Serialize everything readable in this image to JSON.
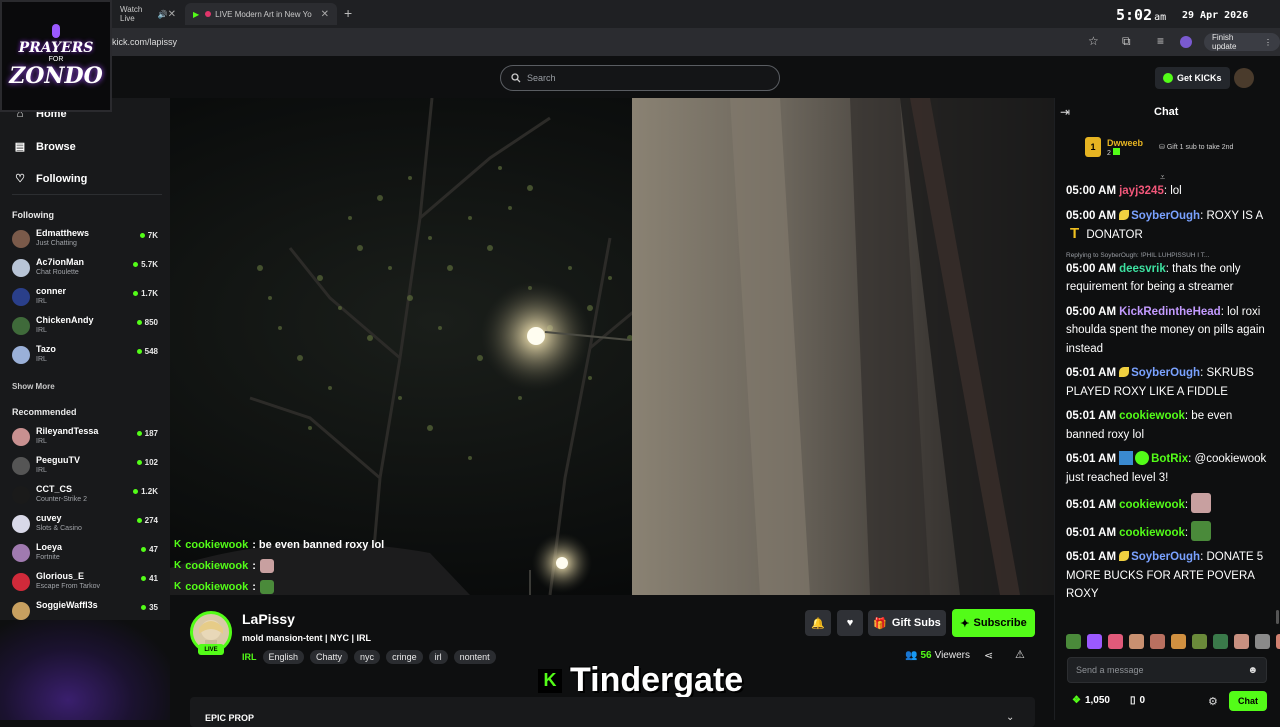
{
  "browser": {
    "tabs": [
      {
        "label": "Watch Live",
        "audio_icon": "speaker-icon"
      },
      {
        "label": "LIVE Modern Art in New Yo"
      }
    ],
    "clock_time": "5:02",
    "clock_ampm": "am",
    "clock_date": "29 Apr 2026",
    "url": "kick.com/lapissy",
    "update_label": "Finish update"
  },
  "overlay_logo": {
    "line1": "PRAYERS",
    "line2": "FOR",
    "line3": "ZONDO"
  },
  "header": {
    "search_placeholder": "Search",
    "get_kicks_label": "Get KICKs"
  },
  "sidebar": {
    "nav": [
      {
        "label": "Home",
        "icon": "home-icon"
      },
      {
        "label": "Browse",
        "icon": "browse-icon"
      },
      {
        "label": "Following",
        "icon": "heart-icon"
      }
    ],
    "following_label": "Following",
    "following": [
      {
        "name": "Edmatthews",
        "category": "Just Chatting",
        "viewers": "7K",
        "color": "#7a5a4a"
      },
      {
        "name": "Ac7ionMan",
        "category": "Chat Roulette",
        "viewers": "5.7K",
        "color": "#b8c4d6"
      },
      {
        "name": "conner",
        "category": "IRL",
        "viewers": "1.7K",
        "color": "#2a3f8a"
      },
      {
        "name": "ChickenAndy",
        "category": "IRL",
        "viewers": "850",
        "color": "#3f6a3a"
      },
      {
        "name": "Tazo",
        "category": "IRL",
        "viewers": "548",
        "color": "#9ab0d8"
      }
    ],
    "show_more_label": "Show More",
    "recommended_label": "Recommended",
    "recommended": [
      {
        "name": "RileyandTessa",
        "category": "IRL",
        "viewers": "187",
        "color": "#c89090"
      },
      {
        "name": "PeeguuTV",
        "category": "IRL",
        "viewers": "102",
        "color": "#555555"
      },
      {
        "name": "CCT_CS",
        "category": "Counter-Strike 2",
        "viewers": "1.2K",
        "color": "#1a1a1a"
      },
      {
        "name": "cuvey",
        "category": "Slots & Casino",
        "viewers": "274",
        "color": "#d8d8e8"
      },
      {
        "name": "Loeya",
        "category": "Fortnite",
        "viewers": "47",
        "color": "#a07ab0"
      },
      {
        "name": "Glorious_E",
        "category": "Escape From Tarkov",
        "viewers": "41",
        "color": "#d02a3a"
      },
      {
        "name": "SoggieWaffl3s",
        "category": "",
        "viewers": "35",
        "color": "#c8a060"
      }
    ]
  },
  "video_overlay_chat": [
    {
      "user": "cookiewook",
      "text": ": be even banned roxy lol",
      "emote_color": ""
    },
    {
      "user": "cookiewook",
      "text": ":",
      "emote_color": "#c8a0a0"
    },
    {
      "user": "cookiewook",
      "text": ":",
      "emote_color": "#4a8a3a"
    }
  ],
  "stream": {
    "streamer": "LaPissy",
    "live_label": "LIVE",
    "title": "mold mansion-tent | NYC | IRL",
    "category": "IRL",
    "tags": [
      "English",
      "Chatty",
      "nyc",
      "cringe",
      "irl",
      "nontent"
    ],
    "gift_subs_label": "Gift Subs",
    "subscribe_label": "Subscribe",
    "viewer_count": "56",
    "viewers_label": "Viewers",
    "ticker_text": "Tindergate",
    "about_title": "EPIC PROP"
  },
  "chat": {
    "title": "Chat",
    "pinned": {
      "rank": "1",
      "name": "Dwweeb",
      "count": "2",
      "gift_text": "Gift 1 sub to take 2nd"
    },
    "messages": [
      {
        "time": "05:00 AM",
        "user": "jayj3245",
        "color": "#f2577a",
        "text": ": lol",
        "badge": ""
      },
      {
        "time": "05:00 AM",
        "user": "SoyberOugh",
        "color": "#7aa2ff",
        "text": ": ROXY IS A ",
        "text2": " DONATOR",
        "badge": "banana"
      },
      {
        "time": "05:00 AM",
        "user": "deesvrik",
        "color": "#3de1a0",
        "text": ": thats the only requirement for being a streamer",
        "badge": "",
        "reply": "Replying to SoyberOugh: !PHIL LUHPISSUH I T..."
      },
      {
        "time": "05:00 AM",
        "user": "KickRedintheHead",
        "color": "#c39bff",
        "text": ": lol roxi shoulda spent the money on pills again instead",
        "badge": ""
      },
      {
        "time": "05:01 AM",
        "user": "SoyberOugh",
        "color": "#7aa2ff",
        "text": ": SKRUBS PLAYED ROXY LIKE A FIDDLE",
        "badge": "banana"
      },
      {
        "time": "05:01 AM",
        "user": "cookiewook",
        "color": "#53fc18",
        "text": ": be even banned roxy lol",
        "badge": ""
      },
      {
        "time": "05:01 AM",
        "user": "BotRix",
        "color": "#53fc18",
        "text": ": @cookiewook just reached level 3!",
        "badge": "bot"
      },
      {
        "time": "05:01 AM",
        "user": "cookiewook",
        "color": "#53fc18",
        "text": ": ",
        "badge": "",
        "emote": "#c8a0a0"
      },
      {
        "time": "05:01 AM",
        "user": "cookiewook",
        "color": "#53fc18",
        "text": ": ",
        "badge": "",
        "emote": "#4a8a3a"
      },
      {
        "time": "05:01 AM",
        "user": "SoyberOugh",
        "color": "#7aa2ff",
        "text": ": DONATE 5 MORE BUCKS FOR ARTE POVERA ROXY",
        "badge": "banana"
      }
    ],
    "emote_colors": [
      "#4a8a3a",
      "#9b59ff",
      "#e05a7a",
      "#c89070",
      "#b87060",
      "#d09040",
      "#6a8a3a",
      "#3a7a4a",
      "#c89080",
      "#8a8a8a",
      "#d08070"
    ],
    "input_placeholder": "Send a message",
    "points_primary": "1,050",
    "points_secondary": "0",
    "chat_button_label": "Chat"
  }
}
